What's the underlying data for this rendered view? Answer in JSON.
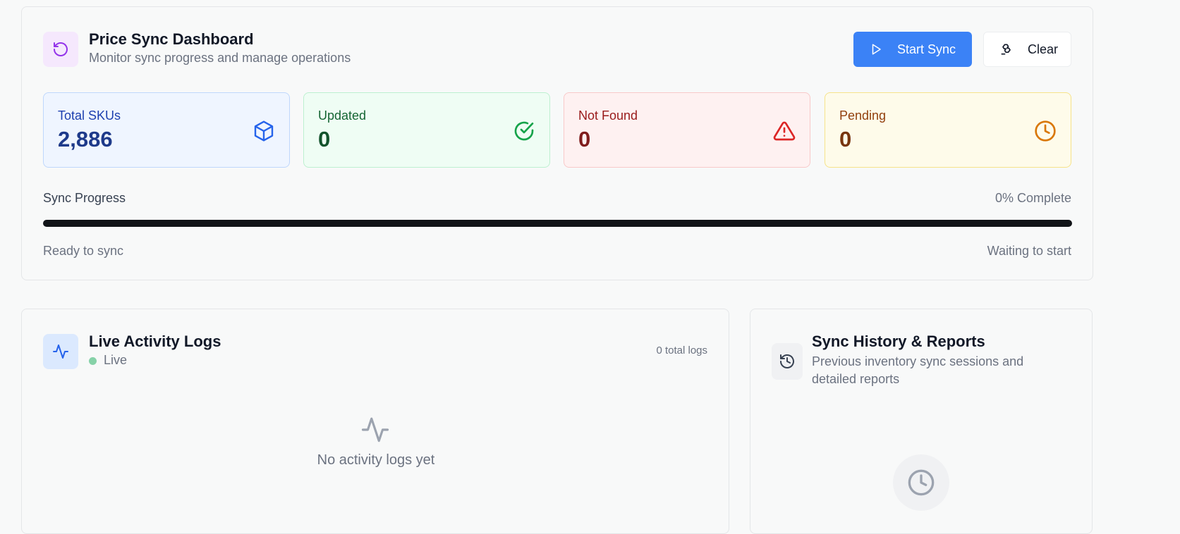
{
  "dashboard": {
    "title": "Price Sync Dashboard",
    "subtitle": "Monitor sync progress and manage operations",
    "header_icon": "refresh-icon",
    "start_label": "Start Sync",
    "clear_label": "Clear",
    "stats": {
      "total": {
        "label": "Total SKUs",
        "value": "2,886",
        "icon": "cube-icon"
      },
      "updated": {
        "label": "Updated",
        "value": "0",
        "icon": "check-circle-icon"
      },
      "not_found": {
        "label": "Not Found",
        "value": "0",
        "icon": "warning-icon"
      },
      "pending": {
        "label": "Pending",
        "value": "0",
        "icon": "clock-icon"
      }
    },
    "progress": {
      "label": "Sync Progress",
      "percent_text": "0% Complete",
      "percent": 0,
      "status_left": "Ready to sync",
      "status_right": "Waiting to start"
    }
  },
  "logs": {
    "title": "Live Activity Logs",
    "live_label": "Live",
    "count_text": "0 total logs",
    "empty_text": "No activity logs yet"
  },
  "history": {
    "title": "Sync History & Reports",
    "subtitle_line1": "Previous inventory sync sessions and",
    "subtitle_line2": "detailed reports"
  },
  "colors": {
    "primary": "#3b82f6",
    "purple_accent": "#9333ea",
    "green": "#16a34a",
    "red": "#dc2626",
    "amber": "#d97706"
  }
}
